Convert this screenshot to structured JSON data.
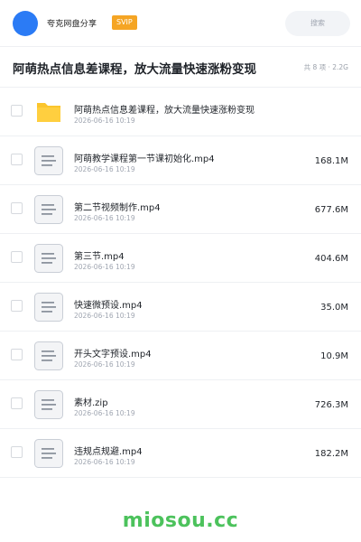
{
  "header": {
    "title": "夸克网盘分享",
    "badge": "SVIP",
    "search_placeholder": "搜索"
  },
  "share": {
    "title": "阿萌热点信息差课程，放大流量快速涨粉变现",
    "meta": "共 8 项 · 2.2G"
  },
  "files": [
    {
      "type": "folder",
      "icon": "folder-icon",
      "name": "阿萌热点信息差课程，放大流量快速涨粉变现",
      "date": "2026-06-16 10:19",
      "size": ""
    },
    {
      "type": "file",
      "icon": "file-icon",
      "name": "阿萌教学课程第一节课初始化.mp4",
      "date": "2026-06-16 10:19",
      "size": "168.1M"
    },
    {
      "type": "file",
      "icon": "file-icon",
      "name": "第二节视频制作.mp4",
      "date": "2026-06-16 10:19",
      "size": "677.6M"
    },
    {
      "type": "file",
      "icon": "file-icon",
      "name": "第三节.mp4",
      "date": "2026-06-16 10:19",
      "size": "404.6M"
    },
    {
      "type": "file",
      "icon": "file-icon",
      "name": "快速微预设.mp4",
      "date": "2026-06-16 10:19",
      "size": "35.0M"
    },
    {
      "type": "file",
      "icon": "file-icon",
      "name": "开头文字预设.mp4",
      "date": "2026-06-16 10:19",
      "size": "10.9M"
    },
    {
      "type": "file",
      "icon": "file-icon",
      "name": "素材.zip",
      "date": "2026-06-16 10:19",
      "size": "726.3M"
    },
    {
      "type": "file",
      "icon": "file-icon",
      "name": "违规点规避.mp4",
      "date": "2026-06-16 10:19",
      "size": "182.2M"
    }
  ],
  "footer": {
    "watermark": "miosou.cc"
  },
  "colors": {
    "accent": "#2b7bf5",
    "badge": "#f5a524",
    "folder": "#fbc52d",
    "watermark": "#4cc25c"
  }
}
